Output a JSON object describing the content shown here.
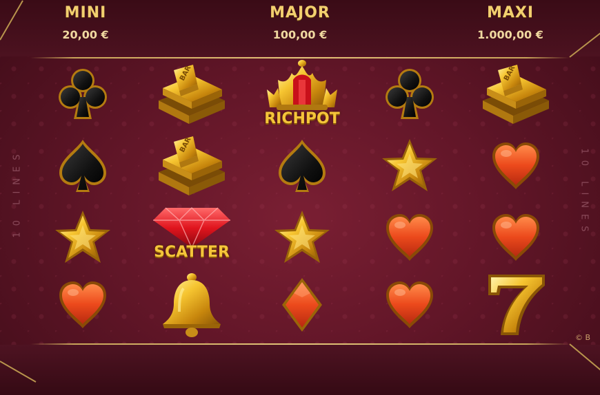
{
  "jackpots": [
    {
      "name": "MINI",
      "value": "20,00 €"
    },
    {
      "name": "MAJOR",
      "value": "100,00 €"
    },
    {
      "name": "MAXI",
      "value": "1.000,00 €"
    }
  ],
  "side_label_left": "10 LINES",
  "side_label_right": "10 LINES",
  "symbols": {
    "richpot_label": "RICHPOT",
    "scatter_label": "SCATTER",
    "bar_label": "BAR"
  },
  "reels": [
    [
      "club",
      "spade",
      "star",
      "heart"
    ],
    [
      "bar",
      "bar",
      "scatter",
      "bell"
    ],
    [
      "richpot",
      "spade",
      "star",
      "diamond"
    ],
    [
      "club",
      "star",
      "heart",
      "heart"
    ],
    [
      "bar",
      "heart",
      "heart",
      "seven"
    ]
  ],
  "copyright": "© B",
  "colors": {
    "background": "#621628",
    "gold": "#f2cf6f",
    "heart": "#e84a1e",
    "black_suit": "#151515"
  }
}
